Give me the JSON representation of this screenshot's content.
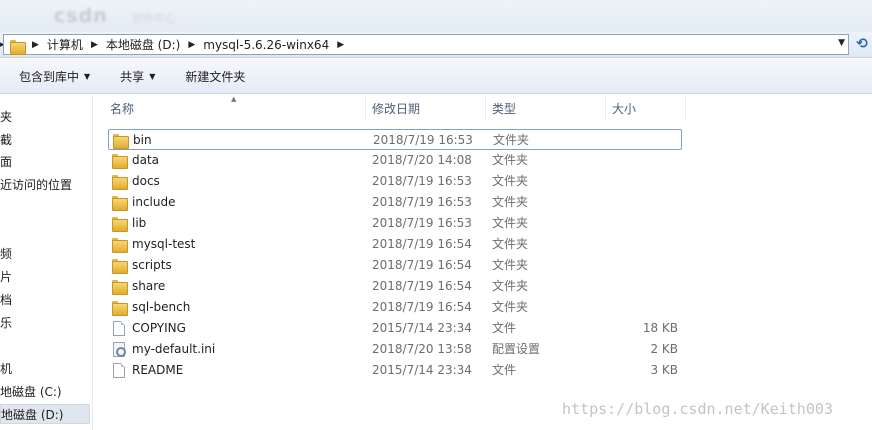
{
  "titlebar": {
    "logo_text": "csdn",
    "logo_sub": "创作中心"
  },
  "address": {
    "crumbs": [
      "计算机",
      "本地磁盘 (D:)",
      "mysql-5.6.26-winx64"
    ],
    "separator": "▶",
    "dropdown": "▼",
    "refresh": "⟲"
  },
  "toolbar": {
    "include_in_library": "包含到库中",
    "share": "共享",
    "new_folder": "新建文件夹"
  },
  "nav": {
    "items": [
      "夹",
      "截",
      "面",
      "近访问的位置",
      "频",
      "片",
      "档",
      "乐",
      "机",
      "地磁盘 (C:)",
      "地磁盘 (D:)"
    ]
  },
  "columns": {
    "name": "名称",
    "modified": "修改日期",
    "type": "类型",
    "size": "大小"
  },
  "files": [
    {
      "name": "bin",
      "date": "2018/7/19 16:53",
      "type": "文件夹",
      "size": "",
      "icon": "folder-icon"
    },
    {
      "name": "data",
      "date": "2018/7/20 14:08",
      "type": "文件夹",
      "size": "",
      "icon": "folder-icon"
    },
    {
      "name": "docs",
      "date": "2018/7/19 16:53",
      "type": "文件夹",
      "size": "",
      "icon": "folder-icon"
    },
    {
      "name": "include",
      "date": "2018/7/19 16:53",
      "type": "文件夹",
      "size": "",
      "icon": "folder-icon"
    },
    {
      "name": "lib",
      "date": "2018/7/19 16:53",
      "type": "文件夹",
      "size": "",
      "icon": "folder-icon"
    },
    {
      "name": "mysql-test",
      "date": "2018/7/19 16:54",
      "type": "文件夹",
      "size": "",
      "icon": "folder-icon"
    },
    {
      "name": "scripts",
      "date": "2018/7/19 16:54",
      "type": "文件夹",
      "size": "",
      "icon": "folder-icon"
    },
    {
      "name": "share",
      "date": "2018/7/19 16:54",
      "type": "文件夹",
      "size": "",
      "icon": "folder-icon"
    },
    {
      "name": "sql-bench",
      "date": "2018/7/19 16:54",
      "type": "文件夹",
      "size": "",
      "icon": "folder-icon"
    },
    {
      "name": "COPYING",
      "date": "2015/7/14 23:34",
      "type": "文件",
      "size": "18 KB",
      "icon": "file-icon"
    },
    {
      "name": "my-default.ini",
      "date": "2018/7/20 13:58",
      "type": "配置设置",
      "size": "2 KB",
      "icon": "settings-file-icon"
    },
    {
      "name": "README",
      "date": "2015/7/14 23:34",
      "type": "文件",
      "size": "3 KB",
      "icon": "file-icon"
    }
  ],
  "watermark": "https://blog.csdn.net/Keith003",
  "colors": {
    "accent": "#2a68b6",
    "folder": "#e9b93a",
    "selection_border": "#7da2ce"
  }
}
